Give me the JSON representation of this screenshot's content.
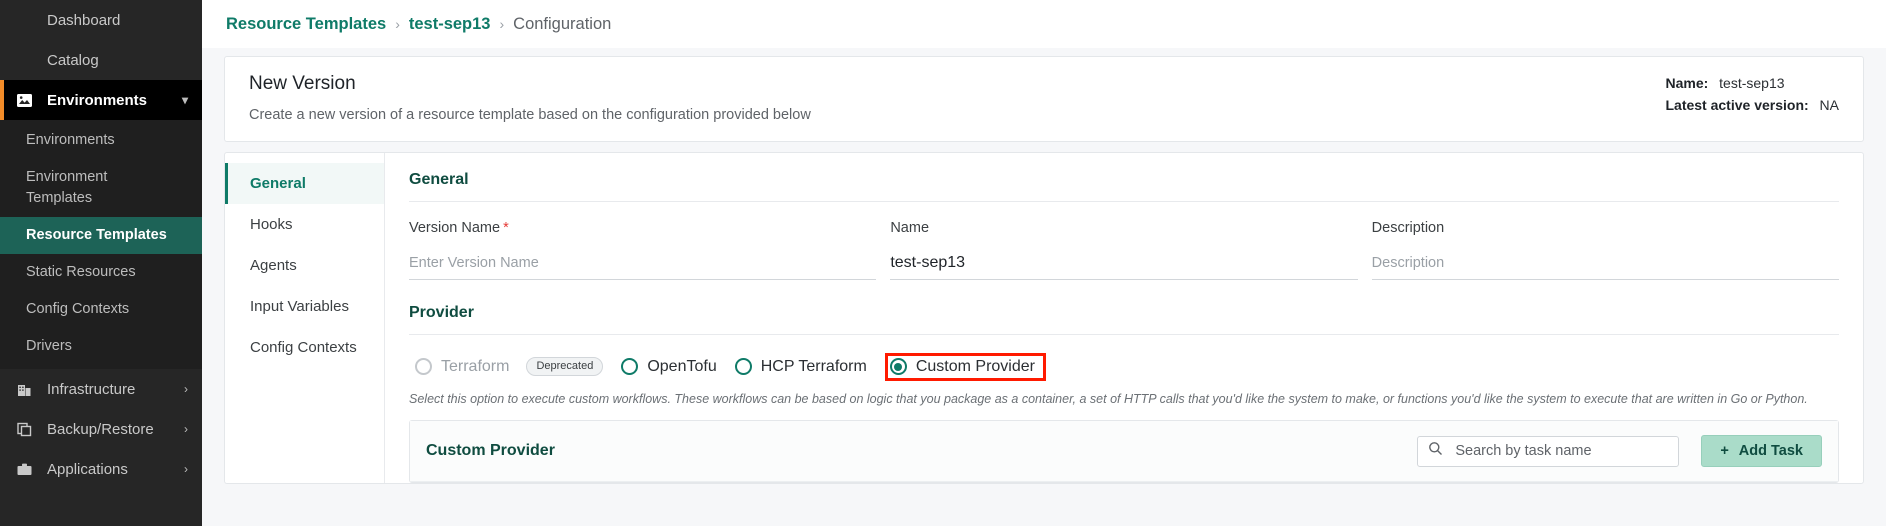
{
  "sidebar": {
    "items": [
      {
        "label": "Dashboard",
        "icon": "grid-icon",
        "active": false,
        "expandable": false
      },
      {
        "label": "Catalog",
        "icon": "catalog-grid-icon",
        "active": false,
        "expandable": false
      },
      {
        "label": "Environments",
        "icon": "environments-icon",
        "active": true,
        "expandable": true,
        "chevron": "chevron-down-icon"
      }
    ],
    "sub_items": [
      {
        "label": "Environments",
        "selected": false
      },
      {
        "label": "Environment Templates",
        "selected": false
      },
      {
        "label": "Resource Templates",
        "selected": true
      },
      {
        "label": "Static Resources",
        "selected": false
      },
      {
        "label": "Config Contexts",
        "selected": false
      },
      {
        "label": "Drivers",
        "selected": false
      }
    ],
    "bottom_items": [
      {
        "label": "Infrastructure",
        "icon": "building-icon",
        "chevron": "chevron-right-icon"
      },
      {
        "label": "Backup/Restore",
        "icon": "copy-icon",
        "chevron": "chevron-right-icon"
      },
      {
        "label": "Applications",
        "icon": "briefcase-icon",
        "chevron": "chevron-right-icon"
      }
    ]
  },
  "breadcrumb": {
    "root": "Resource Templates",
    "sep": "›",
    "middle": "test-sep13",
    "current": "Configuration"
  },
  "header": {
    "title": "New Version",
    "subtitle": "Create a new version of a resource template based on the configuration provided below",
    "meta": [
      {
        "label": "Name:",
        "value": "test-sep13"
      },
      {
        "label": "Latest active version:",
        "value": "NA"
      }
    ]
  },
  "tabs": [
    {
      "label": "General",
      "active": true
    },
    {
      "label": "Hooks",
      "active": false
    },
    {
      "label": "Agents",
      "active": false
    },
    {
      "label": "Input Variables",
      "active": false
    },
    {
      "label": "Config Contexts",
      "active": false
    }
  ],
  "general": {
    "section_title": "General",
    "version_name": {
      "label": "Version Name",
      "required": "*",
      "value": "",
      "placeholder": "Enter Version Name"
    },
    "name": {
      "label": "Name",
      "value": "test-sep13",
      "placeholder": ""
    },
    "description": {
      "label": "Description",
      "value": "",
      "placeholder": "Description"
    }
  },
  "provider": {
    "section_title": "Provider",
    "options": [
      {
        "label": "Terraform",
        "checked": false,
        "disabled": true,
        "badge": "Deprecated",
        "highlight": false
      },
      {
        "label": "OpenTofu",
        "checked": false,
        "disabled": false,
        "badge": "",
        "highlight": false
      },
      {
        "label": "HCP Terraform",
        "checked": false,
        "disabled": false,
        "badge": "",
        "highlight": false
      },
      {
        "label": "Custom Provider",
        "checked": true,
        "disabled": false,
        "badge": "",
        "highlight": true
      }
    ],
    "helper": "Select this option to execute custom workflows. These workflows can be based on logic that you package as a container, a set of HTTP calls that you'd like the system to make, or functions you'd like the system to execute that are written in Go or Python."
  },
  "custom_provider": {
    "title": "Custom Provider",
    "search": {
      "placeholder": "Search by task name",
      "value": "",
      "icon": "search-icon"
    },
    "add_button": {
      "label": "Add Task",
      "icon": "plus-icon"
    }
  },
  "colors": {
    "accent_green": "#0f7b68",
    "dark_green": "#0f4c40",
    "sidebar_bg": "#262626",
    "sidebar_active": "#000000",
    "sidebar_selected": "#1d6357",
    "orange_marker": "#f28c28",
    "highlight_red": "#ff1a00",
    "required_red": "#e53935",
    "button_bg": "#aadcc9"
  }
}
